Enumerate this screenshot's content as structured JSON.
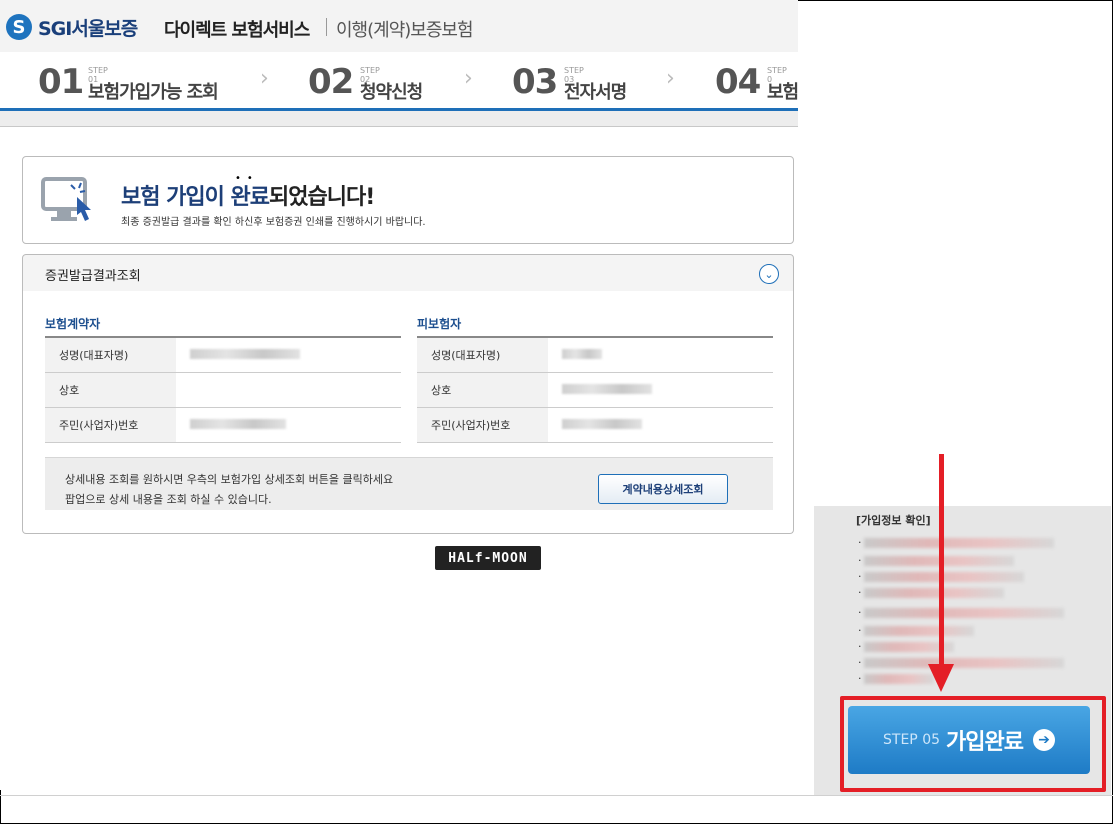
{
  "header": {
    "logo_mark": "S",
    "logo_text": "SGI서울보증",
    "service_title": "다이렉트 보험서비스",
    "service_sub": "이행(계약)보증보험"
  },
  "steps": [
    {
      "num": "01",
      "small": "STEP 01",
      "label": "보험가입가능 조회"
    },
    {
      "num": "02",
      "small": "STEP 02",
      "label": "청약신청"
    },
    {
      "num": "03",
      "small": "STEP 03",
      "label": "전자서명"
    },
    {
      "num": "04",
      "small": "STEP 0",
      "label": "보험"
    }
  ],
  "chevron": "›",
  "done": {
    "title_highlight": "보험 가입이 완료",
    "title_rest": "되었습니다!",
    "dots": "••",
    "description": "최종 증권발급 결과를 확인 하신후 보험증권 인쇄를 진행하시기 바랍니다."
  },
  "result": {
    "title": "증권발급결과조회",
    "collapse_icon": "⌄",
    "contractor": {
      "title": "보험계약자",
      "rows": [
        {
          "label": "성명(대표자명)"
        },
        {
          "label": "상호"
        },
        {
          "label": "주민(사업자)번호"
        }
      ]
    },
    "insured": {
      "title": "피보험자",
      "rows": [
        {
          "label": "성명(대표자명)"
        },
        {
          "label": "상호"
        },
        {
          "label": "주민(사업자)번호"
        }
      ]
    },
    "notice_line1": "상세내용 조회를 원하시면 우측의 보험가입 상세조회 버튼을 클릭하세요",
    "notice_line2": "팝업으로 상세 내용을 조회 하실 수 있습니다.",
    "detail_button": "계약내용상세조회"
  },
  "watermark": "HALf-MOON",
  "right_panel": {
    "title": "[가입정보 확인]",
    "bullet": "·"
  },
  "step5": {
    "small": "STEP 05",
    "label": "가입완료",
    "icon": "➔"
  },
  "colors": {
    "accent": "#1e6fb8",
    "highlight_red": "#e41e26",
    "step5_button": "#2a8ad3"
  }
}
